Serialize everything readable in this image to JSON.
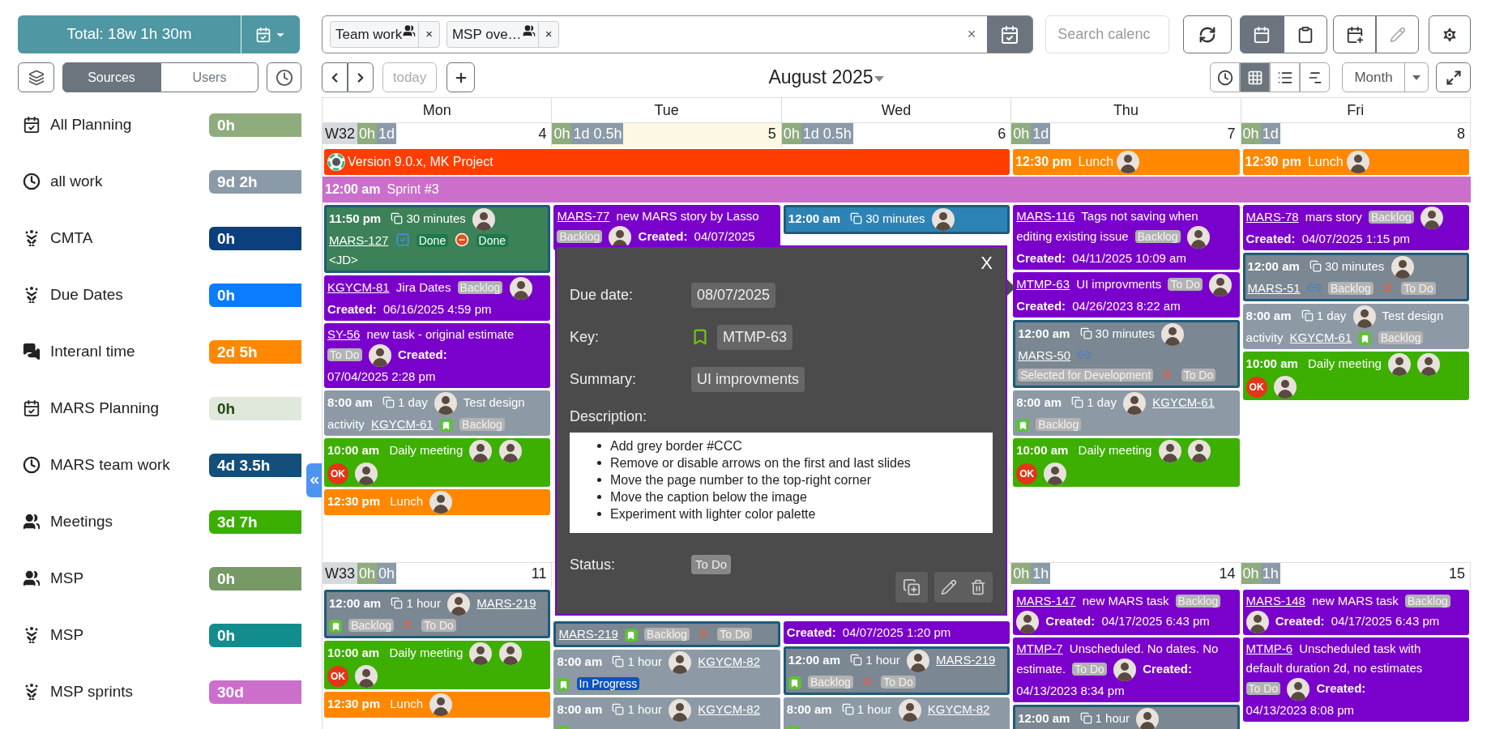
{
  "header": {
    "total": "Total: 18w 1h 30m",
    "filters": [
      {
        "label": "Team work",
        "remove": "×"
      },
      {
        "label": "MSP ove…",
        "remove": "×"
      }
    ],
    "clear": "×",
    "search": {
      "placeholder": "Search calenc"
    },
    "views": [
      {
        "selected": true
      },
      {
        "selected": false
      }
    ]
  },
  "sidebar": {
    "tabs": [
      {
        "label": "Sources",
        "selected": true
      },
      {
        "label": "Users",
        "selected": false
      }
    ],
    "sources": [
      {
        "kind": "planning",
        "name": "All Planning",
        "total": "0h",
        "color": "#8fac7c"
      },
      {
        "kind": "worklog",
        "name": "all work",
        "total": "9d 2h",
        "color": "#8a9aa8"
      },
      {
        "kind": "jira",
        "name": "CMTA",
        "total": "0h",
        "color": "#0b3f7d"
      },
      {
        "kind": "jira",
        "name": "Due Dates",
        "total": "0h",
        "color": "#0a7cff"
      },
      {
        "kind": "chat",
        "name": "Interanl time",
        "total": "2d 5h",
        "color": "#ff8800"
      },
      {
        "kind": "planning",
        "name": "MARS Planning",
        "total": "0h",
        "color": "#e0e8dc"
      },
      {
        "kind": "worklog",
        "name": "MARS team work",
        "total": "4d 3.5h",
        "color": "#134f7a"
      },
      {
        "kind": "team",
        "name": "Meetings",
        "total": "3d 7h",
        "color": "#3aaf00"
      },
      {
        "kind": "team",
        "name": "MSP",
        "total": "0h",
        "color": "#779966"
      },
      {
        "kind": "jira",
        "name": "MSP",
        "total": "0h",
        "color": "#128c8c"
      },
      {
        "kind": "jira",
        "name": "MSP sprints",
        "total": "30d",
        "color": "#cc6ecc"
      }
    ]
  },
  "nav": {
    "today": {
      "label": "today",
      "disabled": true
    },
    "title": "August 2025",
    "modes": [
      {
        "selected": false
      },
      {
        "selected": true
      },
      {
        "selected": false
      },
      {
        "selected": false
      }
    ],
    "range": "Month"
  },
  "calendar": {
    "days": [
      "Mon",
      "Tue",
      "Wed",
      "Thu",
      "Fri"
    ],
    "weeks": [
      {
        "label": "W32",
        "cells": [
          {
            "number": "4",
            "today": false,
            "tags": [
              {
                "text": "0h",
                "color": "#8fac7c"
              },
              {
                "text": "1d",
                "color": "#8a9aa8"
              }
            ],
            "events": [
              {
                "color": "#3c8158",
                "outlined": true,
                "parts": [
                  {
                    "kind": "time",
                    "text": "11:50 pm"
                  },
                  {
                    "kind": "duration",
                    "text": "30 minutes"
                  },
                  {
                    "kind": "avatar"
                  },
                  {
                    "kind": "link",
                    "text": "MARS-127"
                  },
                  {
                    "kind": "task"
                  },
                  {
                    "kind": "status",
                    "text": "Done",
                    "color": "#1c7a4a"
                  },
                  {
                    "kind": "blocker"
                  },
                  {
                    "kind": "status",
                    "text": "Done",
                    "color": "#1c7a4a"
                  },
                  {
                    "kind": "text",
                    "text": "<JD>"
                  }
                ]
              },
              {
                "color": "#7a00cc",
                "outlined": false,
                "parts": [
                  {
                    "kind": "link",
                    "text": "KGYCM-81"
                  },
                  {
                    "kind": "text",
                    "text": "Jira Dates"
                  },
                  {
                    "kind": "tag",
                    "text": "Backlog"
                  },
                  {
                    "kind": "avatar"
                  },
                  {
                    "kind": "label",
                    "text": "Created:"
                  },
                  {
                    "kind": "text",
                    "text": "06/16/2025 4:59 pm"
                  }
                ]
              },
              {
                "color": "#7a00cc",
                "outlined": false,
                "parts": [
                  {
                    "kind": "link",
                    "text": "SY-56"
                  },
                  {
                    "kind": "text",
                    "text": "new task - original estimate"
                  },
                  {
                    "kind": "tag",
                    "text": "To Do"
                  },
                  {
                    "kind": "avatar"
                  },
                  {
                    "kind": "label",
                    "text": "Created:"
                  },
                  {
                    "kind": "text",
                    "text": "07/04/2025 2:28 pm"
                  }
                ]
              },
              {
                "color": "#8d9aa6",
                "outlined": false,
                "parts": [
                  {
                    "kind": "time",
                    "text": "8:00 am"
                  },
                  {
                    "kind": "duration",
                    "text": "1 day"
                  },
                  {
                    "kind": "avatar"
                  },
                  {
                    "kind": "text",
                    "text": "Test design"
                  },
                  {
                    "kind": "text",
                    "text": "activity"
                  },
                  {
                    "kind": "link",
                    "text": "KGYCM-61"
                  },
                  {
                    "kind": "story"
                  },
                  {
                    "kind": "tag",
                    "text": "Backlog"
                  }
                ]
              },
              {
                "color": "#3daf00",
                "outlined": false,
                "parts": [
                  {
                    "kind": "time",
                    "text": "10:00 am"
                  },
                  {
                    "kind": "text",
                    "text": "Daily meeting"
                  },
                  {
                    "kind": "avatar"
                  },
                  {
                    "kind": "avatar"
                  },
                  {
                    "kind": "ok",
                    "text": "OK"
                  },
                  {
                    "kind": "avatar"
                  }
                ]
              },
              {
                "color": "#ff8800",
                "outlined": false,
                "parts": [
                  {
                    "kind": "time",
                    "text": "12:30 pm"
                  },
                  {
                    "kind": "text",
                    "text": "Lunch"
                  },
                  {
                    "kind": "avatar"
                  }
                ]
              }
            ]
          },
          {
            "number": "5",
            "today": true,
            "tags": [
              {
                "text": "0h",
                "color": "#8fac7c"
              },
              {
                "text": "1d 0.5h",
                "color": "#8a9aa8"
              }
            ],
            "events": [
              {
                "color": "#7a00cc",
                "outlined": false,
                "parts": [
                  {
                    "kind": "link",
                    "text": "MARS-77"
                  },
                  {
                    "kind": "text",
                    "text": "new MARS story by Lasso"
                  },
                  {
                    "kind": "tag",
                    "text": "Backlog"
                  },
                  {
                    "kind": "avatar"
                  },
                  {
                    "kind": "label",
                    "text": "Created:"
                  },
                  {
                    "kind": "text",
                    "text": "04/07/2025"
                  }
                ]
              }
            ]
          },
          {
            "number": "6",
            "today": false,
            "tags": [
              {
                "text": "0h",
                "color": "#8fac7c"
              },
              {
                "text": "1d 0.5h",
                "color": "#8a9aa8"
              }
            ],
            "events": [
              {
                "color": "#2d83b5",
                "outlined": true,
                "parts": [
                  {
                    "kind": "time",
                    "text": "12:00 am"
                  },
                  {
                    "kind": "duration",
                    "text": "30 minutes"
                  },
                  {
                    "kind": "avatar"
                  }
                ]
              }
            ]
          },
          {
            "number": "7",
            "today": false,
            "tags": [
              {
                "text": "0h",
                "color": "#8fac7c"
              },
              {
                "text": "1d",
                "color": "#8a9aa8"
              }
            ],
            "events": [
              {
                "color": "#7a00cc",
                "outlined": false,
                "parts": [
                  {
                    "kind": "link",
                    "text": "MARS-116"
                  },
                  {
                    "kind": "text",
                    "text": "Tags not saving when"
                  },
                  {
                    "kind": "text",
                    "text": "editing existing issue"
                  },
                  {
                    "kind": "tag",
                    "text": "Backlog"
                  },
                  {
                    "kind": "avatar"
                  },
                  {
                    "kind": "label",
                    "text": "Created:"
                  },
                  {
                    "kind": "text",
                    "text": "04/11/2025 10:09 am"
                  }
                ]
              },
              {
                "color": "#7a00cc",
                "outlined": false,
                "parts": [
                  {
                    "kind": "link",
                    "text": "MTMP-63"
                  },
                  {
                    "kind": "text",
                    "text": "UI improvments"
                  },
                  {
                    "kind": "tag",
                    "text": "To Do"
                  },
                  {
                    "kind": "avatar"
                  },
                  {
                    "kind": "label",
                    "text": "Created:"
                  },
                  {
                    "kind": "text",
                    "text": "04/26/2023 8:22 am"
                  }
                ]
              },
              {
                "color": "#7b8792",
                "outlined": true,
                "parts": [
                  {
                    "kind": "time",
                    "text": "12:00 am"
                  },
                  {
                    "kind": "duration",
                    "text": "30 minutes"
                  },
                  {
                    "kind": "avatar"
                  },
                  {
                    "kind": "link",
                    "text": "MARS-50"
                  },
                  {
                    "kind": "subtask"
                  },
                  {
                    "kind": "tag",
                    "text": "Selected for Development"
                  },
                  {
                    "kind": "priority"
                  },
                  {
                    "kind": "tag",
                    "text": "To Do"
                  }
                ]
              },
              {
                "color": "#8d9aa6",
                "outlined": false,
                "parts": [
                  {
                    "kind": "time",
                    "text": "8:00 am"
                  },
                  {
                    "kind": "duration",
                    "text": "1 day"
                  },
                  {
                    "kind": "avatar"
                  },
                  {
                    "kind": "link",
                    "text": "KGYCM-61"
                  },
                  {
                    "kind": "story"
                  },
                  {
                    "kind": "tag",
                    "text": "Backlog"
                  }
                ]
              },
              {
                "color": "#3daf00",
                "outlined": false,
                "parts": [
                  {
                    "kind": "time",
                    "text": "10:00 am"
                  },
                  {
                    "kind": "text",
                    "text": "Daily meeting"
                  },
                  {
                    "kind": "avatar"
                  },
                  {
                    "kind": "avatar"
                  },
                  {
                    "kind": "ok",
                    "text": "OK"
                  },
                  {
                    "kind": "avatar"
                  }
                ]
              }
            ]
          },
          {
            "number": "8",
            "today": false,
            "tags": [
              {
                "text": "0h",
                "color": "#8fac7c"
              },
              {
                "text": "1d",
                "color": "#8a9aa8"
              }
            ],
            "events": [
              {
                "color": "#7a00cc",
                "outlined": false,
                "parts": [
                  {
                    "kind": "link",
                    "text": "MARS-78"
                  },
                  {
                    "kind": "text",
                    "text": "mars story"
                  },
                  {
                    "kind": "tag",
                    "text": "Backlog"
                  },
                  {
                    "kind": "avatar"
                  },
                  {
                    "kind": "label",
                    "text": "Created:"
                  },
                  {
                    "kind": "text",
                    "text": "04/07/2025 1:15 pm"
                  }
                ]
              },
              {
                "color": "#7b8792",
                "outlined": true,
                "parts": [
                  {
                    "kind": "time",
                    "text": "12:00 am"
                  },
                  {
                    "kind": "duration",
                    "text": "30 minutes"
                  },
                  {
                    "kind": "avatar"
                  },
                  {
                    "kind": "link",
                    "text": "MARS-51"
                  },
                  {
                    "kind": "subtask"
                  },
                  {
                    "kind": "tag",
                    "text": "Backlog"
                  },
                  {
                    "kind": "priority"
                  },
                  {
                    "kind": "tag",
                    "text": "To Do"
                  }
                ]
              },
              {
                "color": "#8d9aa6",
                "outlined": false,
                "parts": [
                  {
                    "kind": "time",
                    "text": "8:00 am"
                  },
                  {
                    "kind": "duration",
                    "text": "1 day"
                  },
                  {
                    "kind": "avatar"
                  },
                  {
                    "kind": "text",
                    "text": "Test design"
                  },
                  {
                    "kind": "text",
                    "text": "activity"
                  },
                  {
                    "kind": "link",
                    "text": "KGYCM-61"
                  },
                  {
                    "kind": "story"
                  },
                  {
                    "kind": "tag",
                    "text": "Backlog"
                  }
                ]
              },
              {
                "color": "#3daf00",
                "outlined": false,
                "parts": [
                  {
                    "kind": "time",
                    "text": "10:00 am"
                  },
                  {
                    "kind": "text",
                    "text": "Daily meeting"
                  },
                  {
                    "kind": "avatar"
                  },
                  {
                    "kind": "avatar"
                  },
                  {
                    "kind": "ok",
                    "text": "OK"
                  },
                  {
                    "kind": "avatar"
                  }
                ]
              }
            ]
          }
        ],
        "rows": [
          [
            {
              "kind": "bar",
              "color": "#ff3d00",
              "parts": [
                {
                  "kind": "logo"
                },
                {
                  "kind": "text",
                  "text": "Version 9.0.x, MK Project"
                }
              ]
            },
            {
              "kind": "continued"
            },
            {
              "kind": "continued"
            },
            {
              "kind": "bar",
              "color": "#ff8800",
              "parts": [
                {
                  "kind": "time",
                  "text": "12:30 pm"
                },
                {
                  "kind": "text",
                  "text": "Lunch"
                },
                {
                  "kind": "avatar"
                }
              ]
            },
            {
              "kind": "bar",
              "color": "#ff8800",
              "parts": [
                {
                  "kind": "time",
                  "text": "12:30 pm"
                },
                {
                  "kind": "text",
                  "text": "Lunch"
                },
                {
                  "kind": "avatar"
                }
              ]
            }
          ],
          [
            {
              "kind": "bar",
              "color": "#cc6ecc",
              "parts": [
                {
                  "kind": "time",
                  "text": "12:00 am"
                },
                {
                  "kind": "text",
                  "text": "Sprint #3"
                }
              ]
            },
            {
              "kind": "continued"
            },
            {
              "kind": "continued"
            },
            {
              "kind": "continued"
            },
            {
              "kind": "continued"
            }
          ]
        ]
      },
      {
        "label": "W33",
        "cells": [
          {
            "number": "11",
            "today": false,
            "tags": [
              {
                "text": "0h",
                "color": "#8fac7c"
              },
              {
                "text": "0h",
                "color": "#8a9aa8"
              }
            ],
            "events": [
              {
                "color": "#7b8792",
                "outlined": true,
                "parts": [
                  {
                    "kind": "time",
                    "text": "12:00 am"
                  },
                  {
                    "kind": "duration",
                    "text": "1 hour"
                  },
                  {
                    "kind": "avatar"
                  },
                  {
                    "kind": "link",
                    "text": "MARS-219"
                  },
                  {
                    "kind": "story"
                  },
                  {
                    "kind": "tag",
                    "text": "Backlog"
                  },
                  {
                    "kind": "priority"
                  },
                  {
                    "kind": "tag",
                    "text": "To Do"
                  }
                ]
              },
              {
                "color": "#3daf00",
                "outlined": false,
                "parts": [
                  {
                    "kind": "time",
                    "text": "10:00 am"
                  },
                  {
                    "kind": "text",
                    "text": "Daily meeting"
                  },
                  {
                    "kind": "avatar"
                  },
                  {
                    "kind": "avatar"
                  },
                  {
                    "kind": "ok",
                    "text": "OK"
                  },
                  {
                    "kind": "avatar"
                  }
                ]
              },
              {
                "color": "#ff8800",
                "outlined": false,
                "parts": [
                  {
                    "kind": "time",
                    "text": "12:30 pm"
                  },
                  {
                    "kind": "text",
                    "text": "Lunch"
                  },
                  {
                    "kind": "avatar"
                  }
                ]
              }
            ]
          },
          {
            "events": [
              {
                "color": "#7b8792",
                "outlined": true,
                "parts": [
                  {
                    "kind": "link",
                    "text": "MARS-219"
                  },
                  {
                    "kind": "story"
                  },
                  {
                    "kind": "tag",
                    "text": "Backlog"
                  },
                  {
                    "kind": "priority"
                  },
                  {
                    "kind": "tag",
                    "text": "To Do"
                  }
                ]
              },
              {
                "color": "#8d9aa6",
                "outlined": false,
                "parts": [
                  {
                    "kind": "time",
                    "text": "8:00 am"
                  },
                  {
                    "kind": "duration",
                    "text": "1 hour"
                  },
                  {
                    "kind": "avatar"
                  },
                  {
                    "kind": "link",
                    "text": "KGYCM-82"
                  },
                  {
                    "kind": "story"
                  },
                  {
                    "kind": "status",
                    "text": "In Progress",
                    "color": "#0d52bf"
                  }
                ]
              },
              {
                "color": "#8d9aa6",
                "outlined": false,
                "parts": [
                  {
                    "kind": "time",
                    "text": "8:00 am"
                  },
                  {
                    "kind": "duration",
                    "text": "1 hour"
                  },
                  {
                    "kind": "avatar"
                  },
                  {
                    "kind": "link",
                    "text": "KGYCM-82"
                  },
                  {
                    "kind": "story"
                  }
                ]
              }
            ]
          },
          {
            "events": [
              {
                "color": "#7a00cc",
                "outlined": false,
                "parts": [
                  {
                    "kind": "label",
                    "text": "Created:"
                  },
                  {
                    "kind": "text",
                    "text": "04/07/2025 1:20 pm"
                  }
                ]
              },
              {
                "color": "#7b8792",
                "outlined": true,
                "parts": [
                  {
                    "kind": "time",
                    "text": "12:00 am"
                  },
                  {
                    "kind": "duration",
                    "text": "1 hour"
                  },
                  {
                    "kind": "avatar"
                  },
                  {
                    "kind": "link",
                    "text": "MARS-219"
                  },
                  {
                    "kind": "story"
                  },
                  {
                    "kind": "tag",
                    "text": "Backlog"
                  },
                  {
                    "kind": "priority"
                  },
                  {
                    "kind": "tag",
                    "text": "To Do"
                  }
                ]
              },
              {
                "color": "#8d9aa6",
                "outlined": false,
                "parts": [
                  {
                    "kind": "time",
                    "text": "8:00 am"
                  },
                  {
                    "kind": "duration",
                    "text": "1 hour"
                  },
                  {
                    "kind": "avatar"
                  },
                  {
                    "kind": "link",
                    "text": "KGYCM-82"
                  },
                  {
                    "kind": "story"
                  }
                ]
              }
            ]
          },
          {
            "number": "14",
            "today": false,
            "tags": [
              {
                "text": "0h",
                "color": "#8fac7c"
              },
              {
                "text": "1h",
                "color": "#8a9aa8"
              }
            ],
            "events": [
              {
                "color": "#7a00cc",
                "outlined": false,
                "parts": [
                  {
                    "kind": "link",
                    "text": "MARS-147"
                  },
                  {
                    "kind": "text",
                    "text": "new MARS task"
                  },
                  {
                    "kind": "tag",
                    "text": "Backlog"
                  },
                  {
                    "kind": "avatar"
                  },
                  {
                    "kind": "label",
                    "text": "Created:"
                  },
                  {
                    "kind": "text",
                    "text": "04/17/2025 6:43 pm"
                  }
                ]
              },
              {
                "color": "#7a00cc",
                "outlined": false,
                "parts": [
                  {
                    "kind": "link",
                    "text": "MTMP-7"
                  },
                  {
                    "kind": "text",
                    "text": "Unscheduled. No dates. No"
                  },
                  {
                    "kind": "text",
                    "text": "estimate."
                  },
                  {
                    "kind": "tag",
                    "text": "To Do"
                  },
                  {
                    "kind": "avatar"
                  },
                  {
                    "kind": "label",
                    "text": "Created:"
                  },
                  {
                    "kind": "text",
                    "text": "04/13/2023 8:34 pm"
                  }
                ]
              },
              {
                "color": "#7b8792",
                "outlined": true,
                "parts": [
                  {
                    "kind": "time",
                    "text": "12:00 am"
                  },
                  {
                    "kind": "duration",
                    "text": "1 hour"
                  },
                  {
                    "kind": "avatar"
                  }
                ]
              }
            ]
          },
          {
            "number": "15",
            "today": false,
            "tags": [
              {
                "text": "0h",
                "color": "#8fac7c"
              },
              {
                "text": "1h",
                "color": "#8a9aa8"
              }
            ],
            "events": [
              {
                "color": "#7a00cc",
                "outlined": false,
                "parts": [
                  {
                    "kind": "link",
                    "text": "MARS-148"
                  },
                  {
                    "kind": "text",
                    "text": "new MARS task"
                  },
                  {
                    "kind": "tag",
                    "text": "Backlog"
                  },
                  {
                    "kind": "avatar"
                  },
                  {
                    "kind": "label",
                    "text": "Created:"
                  },
                  {
                    "kind": "text",
                    "text": "04/17/2025 6:43 pm"
                  }
                ]
              },
              {
                "color": "#7a00cc",
                "outlined": false,
                "parts": [
                  {
                    "kind": "link",
                    "text": "MTMP-6"
                  },
                  {
                    "kind": "text",
                    "text": "Unscheduled task with"
                  },
                  {
                    "kind": "text",
                    "text": "default duration 2d, no estimates"
                  },
                  {
                    "kind": "tag",
                    "text": "To Do"
                  },
                  {
                    "kind": "avatar"
                  },
                  {
                    "kind": "label",
                    "text": "Created:"
                  },
                  {
                    "kind": "text",
                    "text": "04/13/2023 8:08 pm"
                  }
                ]
              }
            ]
          }
        ]
      }
    ]
  },
  "popup": {
    "close": "X",
    "due_label": "Due date:",
    "due": "08/07/2025",
    "key_label": "Key:",
    "key": "MTMP-63",
    "summary_label": "Summary:",
    "summary": "UI improvments",
    "description_label": "Description:",
    "description": [
      "Add grey border #CCC",
      "Remove or disable arrows on the first and last slides",
      "Move the page number to the top-right corner",
      "Move the caption below the image",
      "Experiment with lighter color palette"
    ],
    "status_label": "Status:",
    "status": "To Do"
  }
}
